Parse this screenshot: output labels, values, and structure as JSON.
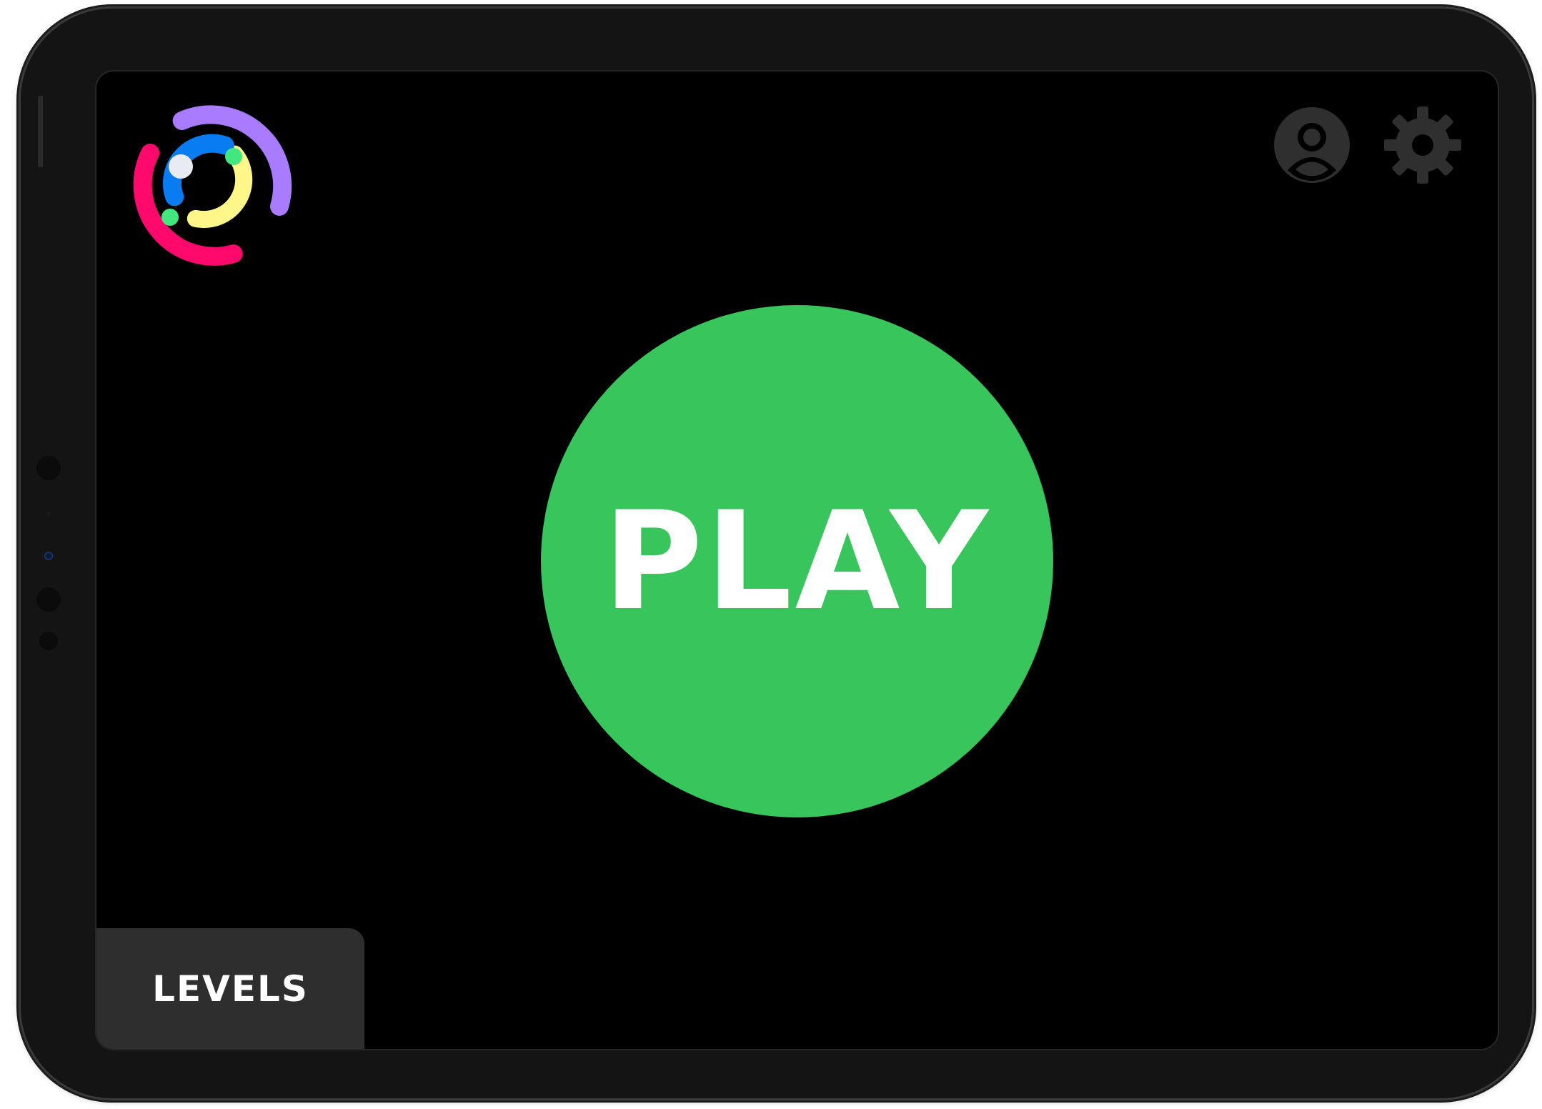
{
  "app": {
    "play_label": "PLAY",
    "levels_label": "LEVELS"
  },
  "icons": {
    "logo": "color-ring-logo-icon",
    "profile": "user-profile-icon",
    "settings": "gear-icon"
  },
  "colors": {
    "screen_background": "#000000",
    "play_button": "#37c55c",
    "levels_button": "#2e2e2e",
    "toolbar_icon": "#2f2f2f",
    "logo_purple": "#a87bff",
    "logo_blue": "#0a7cf2",
    "logo_pink": "#ff0a6c",
    "logo_yellow": "#fff78a",
    "logo_green_dot": "#43e77f",
    "logo_white_dot": "#e8ecf2"
  }
}
